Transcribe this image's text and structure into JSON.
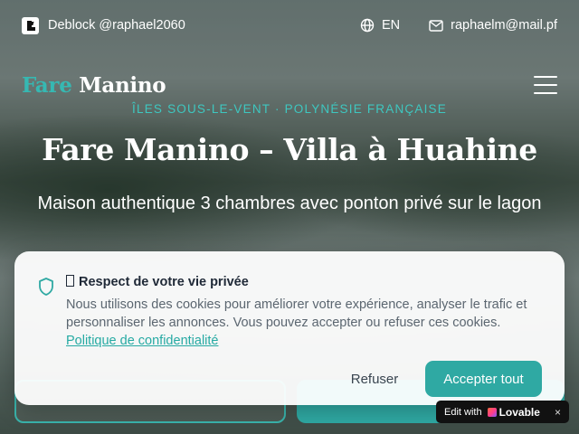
{
  "topbar": {
    "deblock_text": "Deblock @raphael2060",
    "language": "EN",
    "email": "raphaelm@mail.pf"
  },
  "brand": {
    "logo_part1": "Fare",
    "logo_part2": "Manino"
  },
  "hero": {
    "eyebrow": "ÎLES SOUS-LE-VENT · POLYNÉSIE FRANÇAISE",
    "title": "Fare Manino – Villa à Huahine",
    "subtitle": "Maison authentique 3 chambres avec ponton privé sur le lagon"
  },
  "cookie_banner": {
    "title": "Respect de votre vie privée",
    "body": "Nous utilisons des cookies pour améliorer votre expérience, analyser le trafic et personnaliser les annonces. Vous pouvez accepter ou refuser ces cookies.",
    "policy_link": "Politique de confidentialité",
    "refuse_label": "Refuser",
    "accept_label": "Accepter tout"
  },
  "lovable_badge": {
    "edit_text": "Edit with",
    "brand_text": "Lovable",
    "close_glyph": "×"
  },
  "colors": {
    "accent": "#2fa9a3",
    "logo_teal": "#36b8b2",
    "eyebrow": "#3ec7c0"
  },
  "icons": [
    "lovable-logo-icon",
    "globe-icon",
    "mail-icon",
    "menu-icon",
    "shield-icon",
    "cookie-glyph-icon",
    "lovable-heart-icon",
    "close-icon"
  ]
}
